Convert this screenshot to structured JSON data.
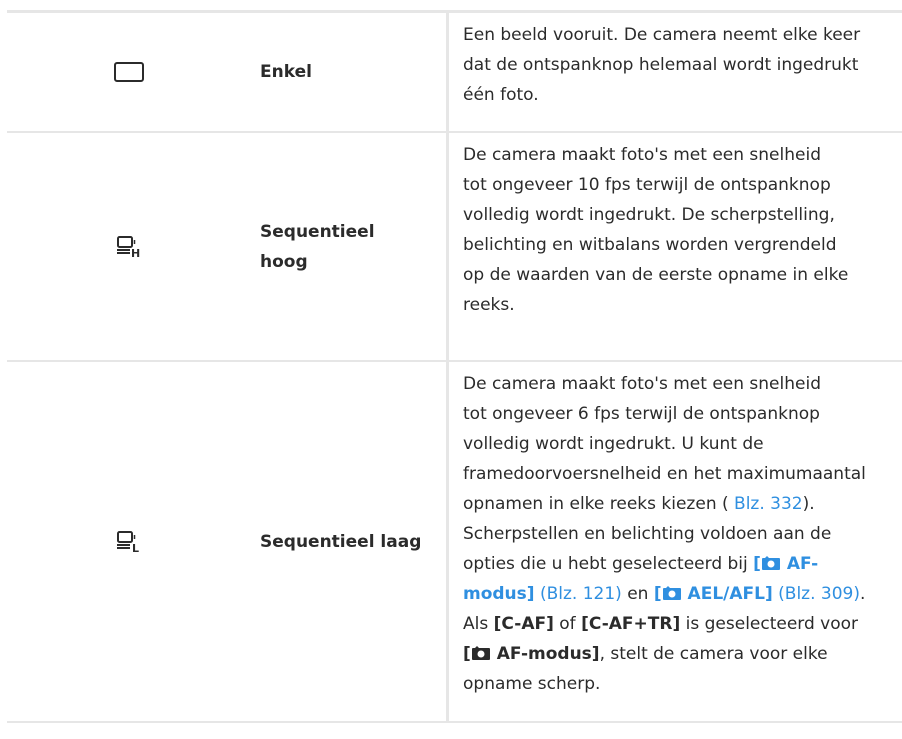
{
  "rows": [
    {
      "icon": "single-frame-icon",
      "name": "Enkel",
      "description": "Een beeld vooruit. De camera neemt elke keer\ndat de ontspanknop helemaal wordt ingedrukt\néén foto."
    },
    {
      "icon": "sequential-high-icon",
      "name": "Sequentieel\nhoog",
      "description": "De camera maakt foto's met een snelheid\ntot ongeveer 10 fps terwijl de ontspanknop\nvolledig wordt ingedrukt. De scherpstelling,\nbelichting en witbalans worden vergrendeld\nop de waarden van de eerste opname in elke\nreeks."
    },
    {
      "icon": "sequential-low-icon",
      "name": "Sequentieel laag",
      "desc": {
        "p1": "De camera maakt foto's met een snelheid\ntot ongeveer 6 fps terwijl de ontspanknop\nvolledig wordt ingedrukt. U kunt de\nframedoorvoersnelheid en het maximumaantal\nopnamen in elke reeks kiezen (",
        "link1": "Blz. 332",
        "p2": ").\nScherpstellen en belichting voldoen aan de\nopties die u hebt geselecteerd bij ",
        "ref1_open": "[",
        "ref1_text": " AF-\nmodus]",
        "ref1_page": "(Blz. 121)",
        "p3": " en ",
        "ref2_open": "[",
        "ref2_text": " AEL/AFL]",
        "ref2_page": "(Blz. 309)",
        "p4": ".\nAls ",
        "b1": "[C-AF]",
        "p5": " of ",
        "b2": "[C-AF+TR]",
        "p6": " is geselecteerd voor\n",
        "b3_open": "[",
        "b3_text": " AF-modus]",
        "p7": ", stelt de camera voor elke\nopname scherp."
      }
    }
  ]
}
